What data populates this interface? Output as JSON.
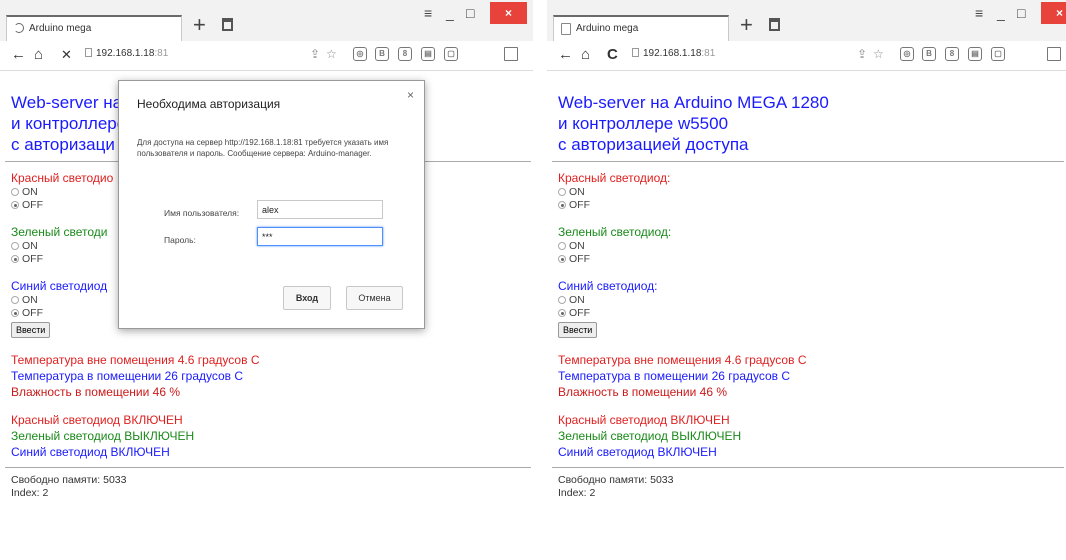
{
  "left": {
    "tab_title": "Arduino mega",
    "address_host": "192.168.1.18",
    "address_port": ":81",
    "heading_lines": [
      "Web-server на",
      "и контроллере",
      "с авторизаци"
    ],
    "sections": [
      {
        "label": "Красный светодио",
        "color": "#e02020",
        "on": "ON",
        "off": "OFF"
      },
      {
        "label": "Зеленый светоди",
        "color": "#1a8a1a",
        "on": "ON",
        "off": "OFF"
      },
      {
        "label": "Синий светодиод",
        "color": "#1a1aff",
        "on": "ON",
        "off": "OFF"
      }
    ],
    "submit_label": "Ввести",
    "temp_lines": [
      {
        "text": "Температура вне помещения 4.6 градусов С",
        "color": "#e02020"
      },
      {
        "text": "Температура в помещении 26 градусов С",
        "color": "#1a1aff"
      },
      {
        "text": "Влажность в помещении 46 %",
        "color": "#cc1a1a"
      }
    ],
    "status_lines": [
      {
        "text": "Красный светодиод ВКЛЮЧЕН",
        "color": "#e02020"
      },
      {
        "text": "Зеленый светодиод ВЫКЛЮЧЕН",
        "color": "#1a8a1a"
      },
      {
        "text": "Синий светодиод ВКЛЮЧЕН",
        "color": "#1a1aff"
      }
    ],
    "footer": {
      "memory": "Свободно памяти: 5033",
      "index": "Index: 2"
    }
  },
  "dialog": {
    "title": "Необходима авторизация",
    "close": "×",
    "message": "Для доступа на сервер http://192.168.1.18:81 требуется указать имя пользователя и пароль. Сообщение сервера: Arduino-manager.",
    "user_label": "Имя пользователя:",
    "user_value": "alex",
    "pass_label": "Пароль:",
    "pass_value": "***",
    "login_button": "Вход",
    "cancel_button": "Отмена"
  },
  "right": {
    "tab_title": "Arduino mega",
    "address_host": "192.168.1.18",
    "address_port": ":81",
    "heading_lines": [
      "Web-server на Arduino MEGA 1280",
      "и контроллере w5500",
      "с авторизацией доступа"
    ],
    "sections": [
      {
        "label": "Красный светодиод:",
        "color": "#e02020",
        "on": "ON",
        "off": "OFF"
      },
      {
        "label": "Зеленый светодиод:",
        "color": "#1a8a1a",
        "on": "ON",
        "off": "OFF"
      },
      {
        "label": "Синий светодиод:",
        "color": "#1a1aff",
        "on": "ON",
        "off": "OFF"
      }
    ],
    "submit_label": "Ввести",
    "temp_lines": [
      {
        "text": "Температура вне помещения 4.6 градусов С",
        "color": "#e02020"
      },
      {
        "text": "Температура в помещении 26 градусов С",
        "color": "#1a1aff"
      },
      {
        "text": "Влажность в помещении 46 %",
        "color": "#cc1a1a"
      }
    ],
    "status_lines": [
      {
        "text": "Красный светодиод ВКЛЮЧЕН",
        "color": "#e02020"
      },
      {
        "text": "Зеленый светодиод ВЫКЛЮЧЕН",
        "color": "#1a8a1a"
      },
      {
        "text": "Синий светодиод ВКЛЮЧЕН",
        "color": "#1a1aff"
      }
    ],
    "footer": {
      "memory": "Свободно памяти: 5033",
      "index": "Index: 2"
    }
  },
  "icons": {
    "new_tab": "+",
    "menu": "≡",
    "minimize": "_",
    "maximize": "□",
    "close": "×",
    "back": "←",
    "home": "⌂",
    "stop": "✕",
    "reload": "C",
    "star": "☆",
    "ext_b": "B",
    "chat": "▭"
  }
}
